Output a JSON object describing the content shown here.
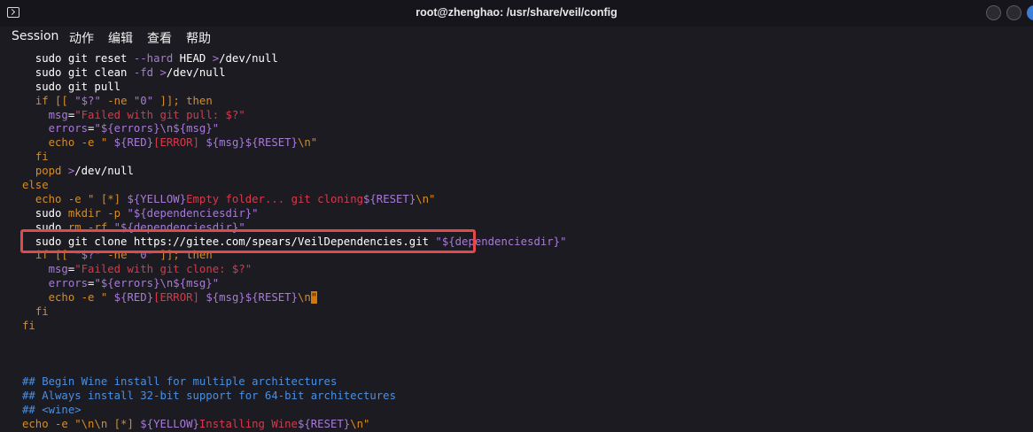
{
  "window": {
    "title": "root@zhenghao: /usr/share/veil/config",
    "icon": "terminal-icon",
    "buttons": [
      "minimize-button",
      "maximize-button",
      "close-button"
    ]
  },
  "menu": [
    "Session",
    "动作",
    "编辑",
    "查看",
    "帮助"
  ],
  "colors": {
    "background": "#1c1b22",
    "purple": "#a77bd6",
    "orange": "#d48d2a",
    "red": "#d33b4c",
    "blue": "#4a8fe0",
    "highlight": "#e24a4a"
  },
  "lines": [
    [
      [
        "  sudo git reset ",
        "w"
      ],
      [
        "--hard",
        "p"
      ],
      [
        " HEAD ",
        "w"
      ],
      [
        ">",
        "p"
      ],
      [
        "/dev/null",
        "w"
      ]
    ],
    [
      [
        "  sudo git clean ",
        "w"
      ],
      [
        "-fd",
        "p"
      ],
      [
        " ",
        "w"
      ],
      [
        ">",
        "p"
      ],
      [
        "/dev/null",
        "w"
      ]
    ],
    [
      [
        "  sudo git pull",
        "w"
      ]
    ],
    [
      [
        "  ",
        "w"
      ],
      [
        "if [[ ",
        "o"
      ],
      [
        "\"$?\"",
        "p"
      ],
      [
        " -ne ",
        "o"
      ],
      [
        "\"0\"",
        "p"
      ],
      [
        " ]]; then",
        "o"
      ]
    ],
    [
      [
        "    ",
        "w"
      ],
      [
        "msg",
        "p"
      ],
      [
        "=",
        "w"
      ],
      [
        "\"Failed with git pull: $?\"",
        "r"
      ]
    ],
    [
      [
        "    ",
        "w"
      ],
      [
        "errors",
        "p"
      ],
      [
        "=",
        "w"
      ],
      [
        "\"${errors}\\n${msg}\"",
        "p"
      ]
    ],
    [
      [
        "    ",
        "w"
      ],
      [
        "echo -e \" ",
        "o"
      ],
      [
        "${RED}",
        "p"
      ],
      [
        "[ERROR] ",
        "r"
      ],
      [
        "${msg}${RESET}",
        "p"
      ],
      [
        "\\n\"",
        "o"
      ]
    ],
    [
      [
        "  ",
        "w"
      ],
      [
        "fi",
        "o"
      ]
    ],
    [
      [
        "  ",
        "w"
      ],
      [
        "popd ",
        "o"
      ],
      [
        ">",
        "p"
      ],
      [
        "/dev/null",
        "w"
      ]
    ],
    [
      [
        "else",
        "o"
      ]
    ],
    [
      [
        "  ",
        "w"
      ],
      [
        "echo -e \" [*] ",
        "o"
      ],
      [
        "${YELLOW}",
        "p"
      ],
      [
        "Empty folder... git cloning",
        "r"
      ],
      [
        "${RESET}",
        "p"
      ],
      [
        "\\n\"",
        "o"
      ]
    ],
    [
      [
        "  sudo ",
        "w"
      ],
      [
        "mkdir -p ",
        "o"
      ],
      [
        "\"${dependenciesdir}\"",
        "p"
      ]
    ],
    [
      [
        "  sudo ",
        "w"
      ],
      [
        "rm -rf ",
        "o"
      ],
      [
        "\"${dependenciesdir}\"",
        "p"
      ]
    ],
    [
      [
        "  sudo git clone https://gitee.com/spears/VeilDependencies.git ",
        "w"
      ],
      [
        "\"${dependenciesdir}\"",
        "p"
      ]
    ],
    [
      [
        "  ",
        "w"
      ],
      [
        "if [[ ",
        "o"
      ],
      [
        "\"$?\"",
        "p"
      ],
      [
        " -ne ",
        "o"
      ],
      [
        "\"0\"",
        "p"
      ],
      [
        " ]]; then",
        "o"
      ]
    ],
    [
      [
        "    ",
        "w"
      ],
      [
        "msg",
        "p"
      ],
      [
        "=",
        "w"
      ],
      [
        "\"Failed with git clone: $?\"",
        "r"
      ]
    ],
    [
      [
        "    ",
        "w"
      ],
      [
        "errors",
        "p"
      ],
      [
        "=",
        "w"
      ],
      [
        "\"${errors}\\n${msg}\"",
        "p"
      ]
    ],
    [
      [
        "    ",
        "w"
      ],
      [
        "echo -e \" ",
        "o"
      ],
      [
        "${RED}",
        "p"
      ],
      [
        "[ERROR] ",
        "r"
      ],
      [
        "${msg}${RESET}",
        "p"
      ],
      [
        "\\n",
        "o"
      ],
      [
        "\"",
        "cursor"
      ]
    ],
    [
      [
        "  ",
        "w"
      ],
      [
        "fi",
        "o"
      ]
    ],
    [
      [
        "fi",
        "o"
      ]
    ],
    [
      [
        "",
        "w"
      ]
    ],
    [
      [
        "",
        "w"
      ]
    ],
    [
      [
        "",
        "w"
      ]
    ],
    [
      [
        "## Begin Wine install for multiple architectures",
        "b"
      ]
    ],
    [
      [
        "## Always install 32-bit support for 64-bit architectures",
        "b"
      ]
    ],
    [
      [
        "## <wine>",
        "b"
      ]
    ],
    [
      [
        "echo -e \"\\n\\n [*] ",
        "o"
      ],
      [
        "${YELLOW}",
        "p"
      ],
      [
        "Installing Wine",
        "r"
      ],
      [
        "${RESET}",
        "p"
      ],
      [
        "\\n\"",
        "o"
      ]
    ]
  ]
}
